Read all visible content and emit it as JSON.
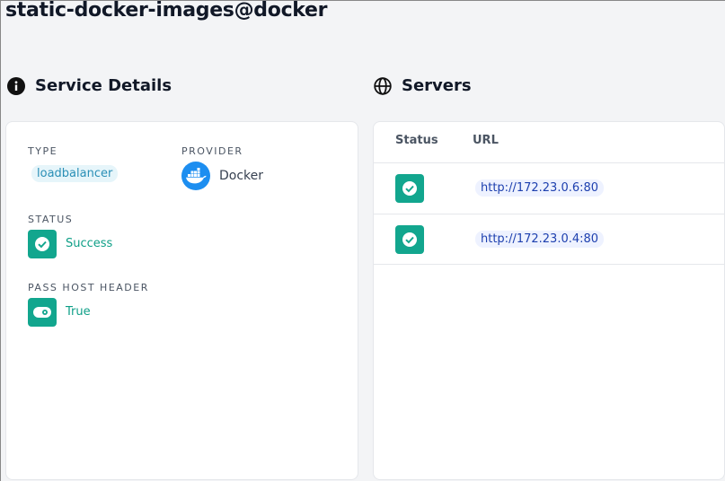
{
  "page": {
    "title": "static-docker-images@docker"
  },
  "service_details": {
    "heading": "Service Details",
    "icon": "info-icon",
    "type": {
      "label": "TYPE",
      "value": "loadbalancer"
    },
    "provider": {
      "label": "PROVIDER",
      "value": "Docker",
      "icon": "docker-icon"
    },
    "status": {
      "label": "STATUS",
      "value": "Success",
      "icon": "check-icon"
    },
    "pass_host_header": {
      "label": "PASS HOST HEADER",
      "value": "True",
      "icon": "toggle-icon"
    }
  },
  "servers": {
    "heading": "Servers",
    "icon": "globe-icon",
    "columns": [
      "Status",
      "URL"
    ],
    "rows": [
      {
        "status": "success",
        "url": "http://172.23.0.6:80"
      },
      {
        "status": "success",
        "url": "http://172.23.0.4:80"
      }
    ]
  },
  "colors": {
    "accent_green": "#12a68e",
    "chip_blue": "#2a8fb6",
    "docker_blue": "#1d8ef0",
    "url_blue": "#1e40af"
  }
}
